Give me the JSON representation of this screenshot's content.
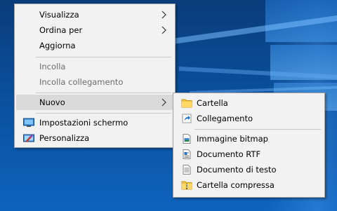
{
  "context_menu": {
    "items": [
      {
        "label": "Visualizza",
        "has_submenu": true
      },
      {
        "label": "Ordina per",
        "has_submenu": true
      },
      {
        "label": "Aggiorna"
      },
      {
        "label": "Incolla",
        "disabled": true
      },
      {
        "label": "Incolla collegamento",
        "disabled": true
      },
      {
        "label": "Nuovo",
        "has_submenu": true,
        "highlighted": true
      },
      {
        "label": "Impostazioni schermo",
        "icon": "display-settings-icon"
      },
      {
        "label": "Personalizza",
        "icon": "personalize-icon"
      }
    ]
  },
  "new_submenu": {
    "items": [
      {
        "label": "Cartella",
        "icon": "folder-icon"
      },
      {
        "label": "Collegamento",
        "icon": "shortcut-icon"
      },
      {
        "label": "Immagine bitmap",
        "icon": "bitmap-icon"
      },
      {
        "label": "Documento RTF",
        "icon": "rtf-document-icon"
      },
      {
        "label": "Documento di testo",
        "icon": "text-document-icon"
      },
      {
        "label": "Cartella compressa",
        "icon": "zip-folder-icon"
      }
    ]
  },
  "colors": {
    "menu_background": "#f2f2f2",
    "highlight": "#dadada",
    "disabled_text": "#6d6d6d",
    "desktop_accent": "#0a4f9c"
  }
}
